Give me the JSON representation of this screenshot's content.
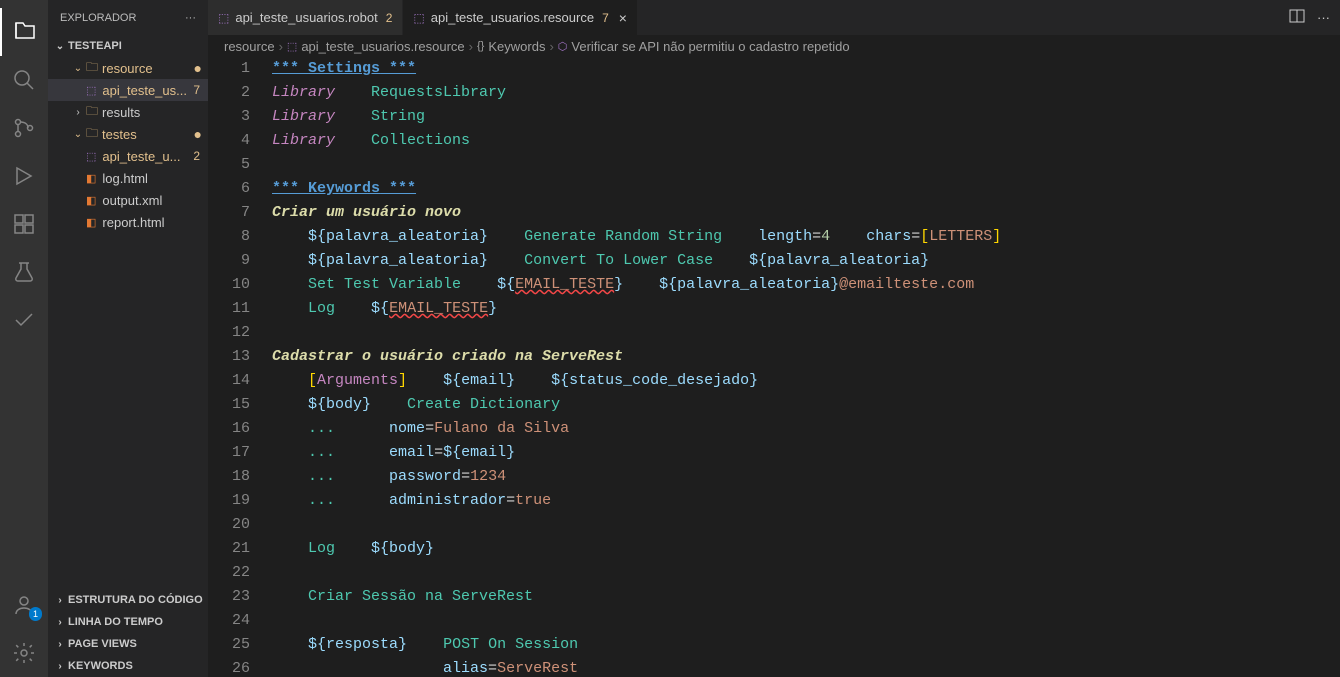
{
  "sidebar": {
    "title": "EXPLORADOR",
    "project": "TESTEAPI",
    "tree": [
      {
        "type": "folder",
        "label": "resource",
        "indent": 1,
        "open": true,
        "modified": "dot"
      },
      {
        "type": "file",
        "label": "api_teste_us...",
        "indent": 2,
        "icon": "purple",
        "modified": "7",
        "color": "file-resource",
        "active": true
      },
      {
        "type": "folder",
        "label": "results",
        "indent": 1,
        "open": false
      },
      {
        "type": "folder",
        "label": "testes",
        "indent": 1,
        "open": true,
        "modified": "dot"
      },
      {
        "type": "file",
        "label": "api_teste_u...",
        "indent": 2,
        "icon": "purple",
        "modified": "2",
        "color": "file-resource"
      },
      {
        "type": "file",
        "label": "log.html",
        "indent": 2,
        "icon": "orange"
      },
      {
        "type": "file",
        "label": "output.xml",
        "indent": 2,
        "icon": "orange"
      },
      {
        "type": "file",
        "label": "report.html",
        "indent": 2,
        "icon": "orange"
      }
    ],
    "sections": [
      "ESTRUTURA DO CÓDIGO",
      "LINHA DO TEMPO",
      "PAGE VIEWS",
      "KEYWORDS"
    ]
  },
  "tabs": [
    {
      "label": "api_teste_usuarios.robot",
      "mod": "2",
      "active": false
    },
    {
      "label": "api_teste_usuarios.resource",
      "mod": "7",
      "active": true,
      "close": true
    }
  ],
  "breadcrumbs": [
    "resource",
    "api_teste_usuarios.resource",
    "Keywords",
    "Verificar se API não permitiu o cadastro repetido"
  ],
  "account_badge": "1",
  "lines": [
    {
      "n": 1,
      "html": "<span class='c-blue-u'>*** </span><span class='c-blue-u'>Settings</span><span class='c-blue-u'> ***</span>"
    },
    {
      "n": 2,
      "html": "<span class='c-italic-purple'>Library</span>    <span class='c-teal'>RequestsLibrary</span>"
    },
    {
      "n": 3,
      "html": "<span class='c-italic-purple'>Library</span>    <span class='c-teal'>String</span>"
    },
    {
      "n": 4,
      "html": "<span class='c-italic-purple'>Library</span>    <span class='c-teal'>Collections</span>"
    },
    {
      "n": 5,
      "html": ""
    },
    {
      "n": 6,
      "html": "<span class='c-blue-u'>*** </span><span class='c-blue-u'>Keywords</span><span class='c-blue-u'> ***</span>"
    },
    {
      "n": 7,
      "html": "<span class='c-yellow'>Criar um usuário novo</span>"
    },
    {
      "n": 8,
      "html": "    <span class='c-lightblue'>${palavra_aleatoria}</span>    <span class='c-teal'>Generate Random String</span>    <span class='c-lightblue'>length</span><span class='c-white'>=</span><span class='c-green'>4</span>    <span class='c-lightblue'>chars</span><span class='c-white'>=</span><span class='c-bracket'>[</span><span class='c-orange'>LETTERS</span><span class='c-bracket'>]</span>"
    },
    {
      "n": 9,
      "html": "    <span class='c-lightblue'>${palavra_aleatoria}</span>    <span class='c-teal'>Convert To Lower Case</span>    <span class='c-lightblue'>${palavra_aleatoria}</span>"
    },
    {
      "n": 10,
      "html": "    <span class='c-teal'>Set Test Variable</span>    <span class='c-lightblue'>${</span><span class='c-orange c-err'>EMAIL_TESTE</span><span class='c-lightblue'>}</span>    <span class='c-lightblue'>${palavra_aleatoria}</span><span class='c-orange'>@emailteste.com</span>"
    },
    {
      "n": 11,
      "html": "    <span class='c-teal'>Log</span>    <span class='c-lightblue'>${</span><span class='c-orange c-err'>EMAIL_TESTE</span><span class='c-lightblue'>}</span>"
    },
    {
      "n": 12,
      "html": ""
    },
    {
      "n": 13,
      "html": "<span class='c-yellow'>Cadastrar o usuário criado na ServeRest</span>"
    },
    {
      "n": 14,
      "html": "    <span class='c-bracket'>[</span><span class='c-purple'>Arguments</span><span class='c-bracket'>]</span>    <span class='c-lightblue'>${email}</span>    <span class='c-lightblue'>${status_code_desejado}</span>"
    },
    {
      "n": 15,
      "html": "    <span class='c-lightblue'>${body}</span>    <span class='c-teal'>Create Dictionary</span>"
    },
    {
      "n": 16,
      "html": "    <span class='c-teal'>...</span>      <span class='c-lightblue'>nome</span><span class='c-white'>=</span><span class='c-orange'>Fulano da Silva</span>"
    },
    {
      "n": 17,
      "html": "    <span class='c-teal'>...</span>      <span class='c-lightblue'>email</span><span class='c-white'>=</span><span class='c-lightblue'>${email}</span>"
    },
    {
      "n": 18,
      "html": "    <span class='c-teal'>...</span>      <span class='c-lightblue'>password</span><span class='c-white'>=</span><span class='c-orange'>1234</span>"
    },
    {
      "n": 19,
      "html": "    <span class='c-teal'>...</span>      <span class='c-lightblue'>administrador</span><span class='c-white'>=</span><span class='c-orange'>true</span>"
    },
    {
      "n": 20,
      "html": ""
    },
    {
      "n": 21,
      "html": "    <span class='c-teal'>Log</span>    <span class='c-lightblue'>${body}</span>"
    },
    {
      "n": 22,
      "html": ""
    },
    {
      "n": 23,
      "html": "    <span class='c-teal'>Criar Sessão na ServeRest</span>"
    },
    {
      "n": 24,
      "html": ""
    },
    {
      "n": 25,
      "html": "    <span class='c-lightblue'>${resposta}</span>    <span class='c-teal'>POST On Session</span>"
    },
    {
      "n": 26,
      "html": "                   <span class='c-lightblue'>alias</span><span class='c-white'>=</span><span class='c-orange'>ServeRest</span>"
    }
  ]
}
